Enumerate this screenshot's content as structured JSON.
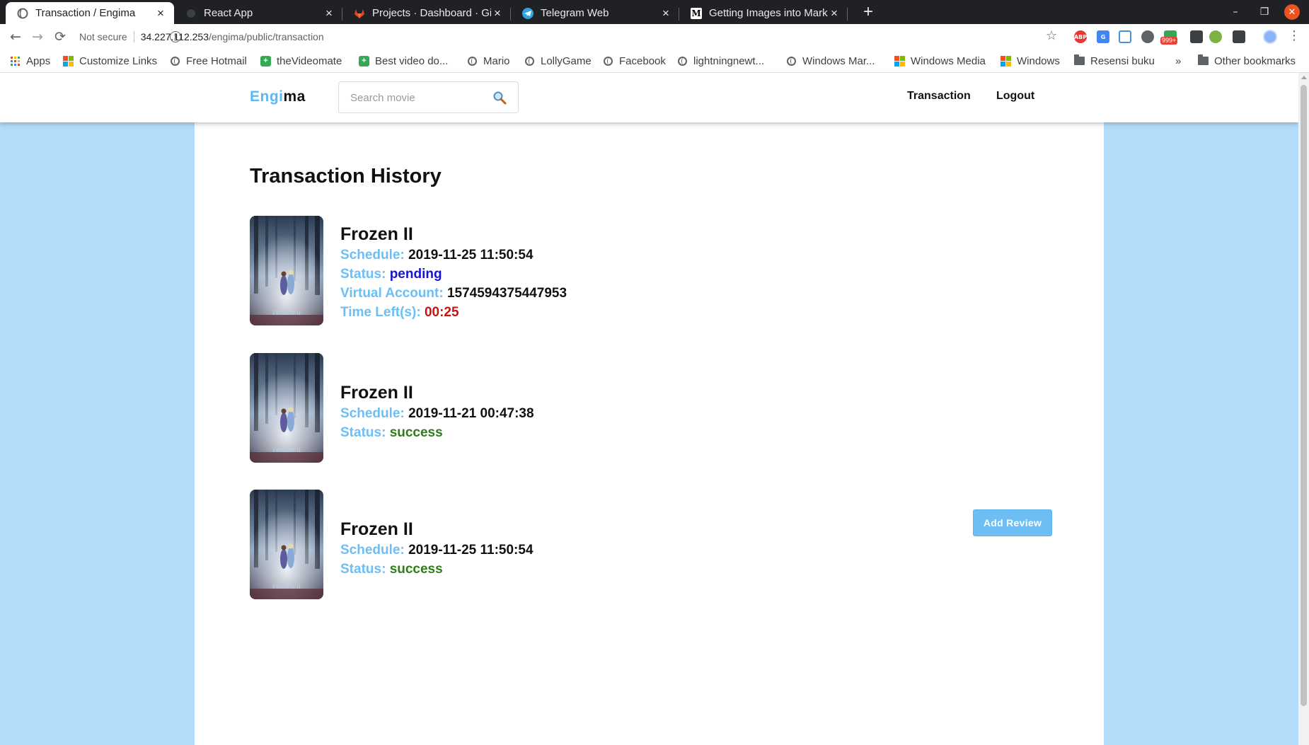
{
  "browser": {
    "tabs": [
      {
        "title": "Transaction / Engima",
        "active": true,
        "favicon": "globe-icon"
      },
      {
        "title": "React App",
        "active": false,
        "favicon": "react-icon"
      },
      {
        "title": "Projects · Dashboard · GitLab",
        "active": false,
        "favicon": "gitlab-icon"
      },
      {
        "title": "Telegram Web",
        "active": false,
        "favicon": "telegram-icon"
      },
      {
        "title": "Getting Images into Markdown",
        "active": false,
        "favicon": "medium-icon"
      }
    ],
    "address": {
      "security": "Not secure",
      "host": "34.227.112.253",
      "path": "/engima/public/transaction"
    },
    "extension_badge": "999+",
    "bookmarks": [
      {
        "label": "Apps",
        "icon": "apps-grid-icon"
      },
      {
        "label": "Customize Links",
        "icon": "windows-icon"
      },
      {
        "label": "Free Hotmail",
        "icon": "globe-icon"
      },
      {
        "label": "theVideomate",
        "icon": "green-plus-icon"
      },
      {
        "label": "Best video do...",
        "icon": "green-plus-icon"
      },
      {
        "label": "Mario",
        "icon": "globe-icon"
      },
      {
        "label": "LollyGame",
        "icon": "globe-icon"
      },
      {
        "label": "Facebook",
        "icon": "globe-icon"
      },
      {
        "label": "lightningnewt...",
        "icon": "globe-icon"
      },
      {
        "label": "Windows Mar...",
        "icon": "globe-icon"
      },
      {
        "label": "Windows Media",
        "icon": "windows-icon"
      },
      {
        "label": "Windows",
        "icon": "windows-icon"
      },
      {
        "label": "Resensi buku",
        "icon": "folder-icon"
      }
    ],
    "overflow": "»",
    "other_bookmarks": "Other bookmarks"
  },
  "site": {
    "logo_part1": "Engi",
    "logo_part2": "ma",
    "search_placeholder": "Search movie",
    "nav": {
      "transaction": "Transaction",
      "logout": "Logout"
    },
    "page_title": "Transaction History",
    "labels": {
      "schedule": "Schedule:",
      "status": "Status:",
      "virtual_account": "Virtual Account:",
      "time_left": "Time Left(s):"
    },
    "transactions": [
      {
        "title": "Frozen II",
        "schedule": "2019-11-25 11:50:54",
        "status": "pending",
        "virtual_account": "1574594375447953",
        "time_left": "00:25"
      },
      {
        "title": "Frozen II",
        "schedule": "2019-11-21 00:47:38",
        "status": "success",
        "action": "Add Review"
      },
      {
        "title": "Frozen II",
        "schedule": "2019-11-25 11:50:54",
        "status": "success"
      }
    ]
  },
  "colors": {
    "accent": "#6cbef5",
    "page_background": "#b3dcfb",
    "status_pending": "#1414d8",
    "status_success": "#2e7d1a",
    "time_left": "#c81414"
  }
}
